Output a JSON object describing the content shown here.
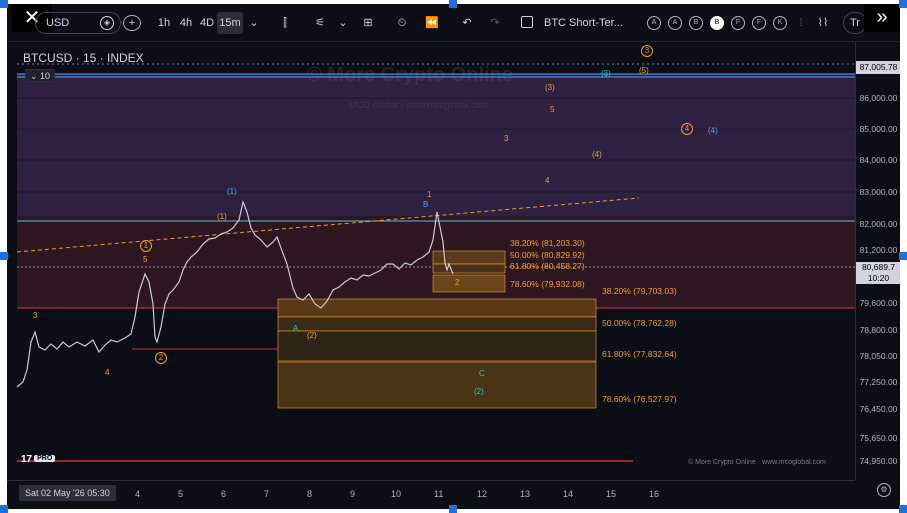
{
  "toolbar": {
    "close_label": "✕",
    "symbol": "USD",
    "add_label": "+",
    "timeframes": [
      "1h",
      "4h",
      "4D",
      "15m"
    ],
    "active_timeframe": "15m",
    "layout_name": "BTC Short-Ter...",
    "circle_buttons": [
      "A",
      "A",
      "B",
      "B",
      "F",
      "F",
      "K"
    ],
    "active_circle_index": 3,
    "expand_label": "»",
    "tr_label": "Tr"
  },
  "chart": {
    "legend_title": "BTCUSD · 15 · INDEX",
    "collapse_badge": "10",
    "watermark_main": "© More Crypto Online",
    "watermark_sub": "MCO Global  |  www.mcoglobal.com",
    "footer_watermark": "© More Crypto Online · www.mcoglobal.com",
    "logo_text": "17",
    "logo_pro": "PRO"
  },
  "price_axis": {
    "labels": [
      "86,000.00",
      "85,000.00",
      "84,000.00",
      "83,000.00",
      "82,000.00",
      "81,200.00",
      "79,600.00",
      "78,800.00",
      "78,050.00",
      "77,250.00",
      "76,450.00",
      "75,650.00",
      "74,950.00"
    ],
    "top_tag": "87,005.78",
    "current_price": "80,689.7",
    "countdown": "10:20"
  },
  "time_axis": {
    "date_pill": "Sat 02 May '26   05:30",
    "labels": [
      "4",
      "5",
      "6",
      "7",
      "8",
      "9",
      "10",
      "11",
      "12",
      "13",
      "14",
      "15",
      "16"
    ],
    "settings_icon": "⚙"
  },
  "fib_levels_upper": [
    "38.20% (81,203.30)",
    "50.00% (80,829.92)",
    "61.80% (80,458.27)",
    "78.60% (79,932.08)"
  ],
  "fib_levels_lower": [
    "38.20% (79,703.03)",
    "50.00% (78,762.28)",
    "61.80% (77,832.64)",
    "78.60% (76,527.97)"
  ],
  "wave_labels": {
    "orange": [
      "3",
      "4",
      "5",
      "(1)",
      "1",
      "3",
      "4",
      "5",
      "(3)",
      "(4)",
      "(5)",
      "(3)",
      "2"
    ],
    "orange_circled": [
      "1",
      "2",
      "3",
      "4"
    ],
    "orange_paren": [
      "(2)"
    ],
    "cyan": [
      "(1)",
      "B",
      "A",
      "C",
      "(2)",
      "(3)",
      "(4)"
    ]
  },
  "colors": {
    "background": "#0b0e14",
    "orange": "#f0a030",
    "cyan": "#26c6da",
    "blue_wave": "#4aa3ff",
    "red_line": "#e03030",
    "purple_zone": "#3a2a55",
    "handle": "#1e6fe0"
  }
}
